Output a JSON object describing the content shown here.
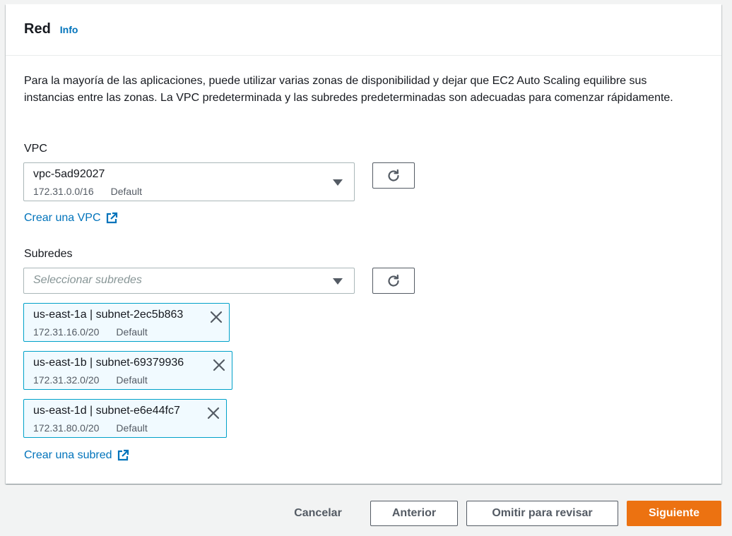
{
  "section": {
    "title": "Red",
    "info_label": "Info",
    "description": "Para la mayoría de las aplicaciones, puede utilizar varias zonas de disponibilidad y dejar que EC2 Auto Scaling equilibre sus instancias entre las zonas. La VPC predeterminada y las subredes predeterminadas son adecuadas para comenzar rápidamente."
  },
  "vpc": {
    "label": "VPC",
    "selected_id": "vpc-5ad92027",
    "selected_cidr": "172.31.0.0/16",
    "selected_tag": "Default",
    "create_link": "Crear una VPC"
  },
  "subnets": {
    "label": "Subredes",
    "placeholder": "Seleccionar subredes",
    "tokens": [
      {
        "label": "us-east-1a | subnet-2ec5b863",
        "cidr": "172.31.16.0/20",
        "tag": "Default"
      },
      {
        "label": "us-east-1b | subnet-69379936",
        "cidr": "172.31.32.0/20",
        "tag": "Default"
      },
      {
        "label": "us-east-1d | subnet-e6e44fc7",
        "cidr": "172.31.80.0/20",
        "tag": "Default"
      }
    ],
    "create_link": "Crear una subred"
  },
  "footer": {
    "cancel_label": "Cancelar",
    "previous_label": "Anterior",
    "skip_label": "Omitir para revisar",
    "next_label": "Siguiente"
  },
  "colors": {
    "link": "#0073bb",
    "primary": "#ec7211",
    "token_border": "#00a1c9",
    "token_bg": "#f1faff"
  },
  "icons": {
    "refresh": "refresh-icon",
    "external": "external-link-icon",
    "dismiss": "close-icon",
    "caret": "caret-down-icon"
  }
}
